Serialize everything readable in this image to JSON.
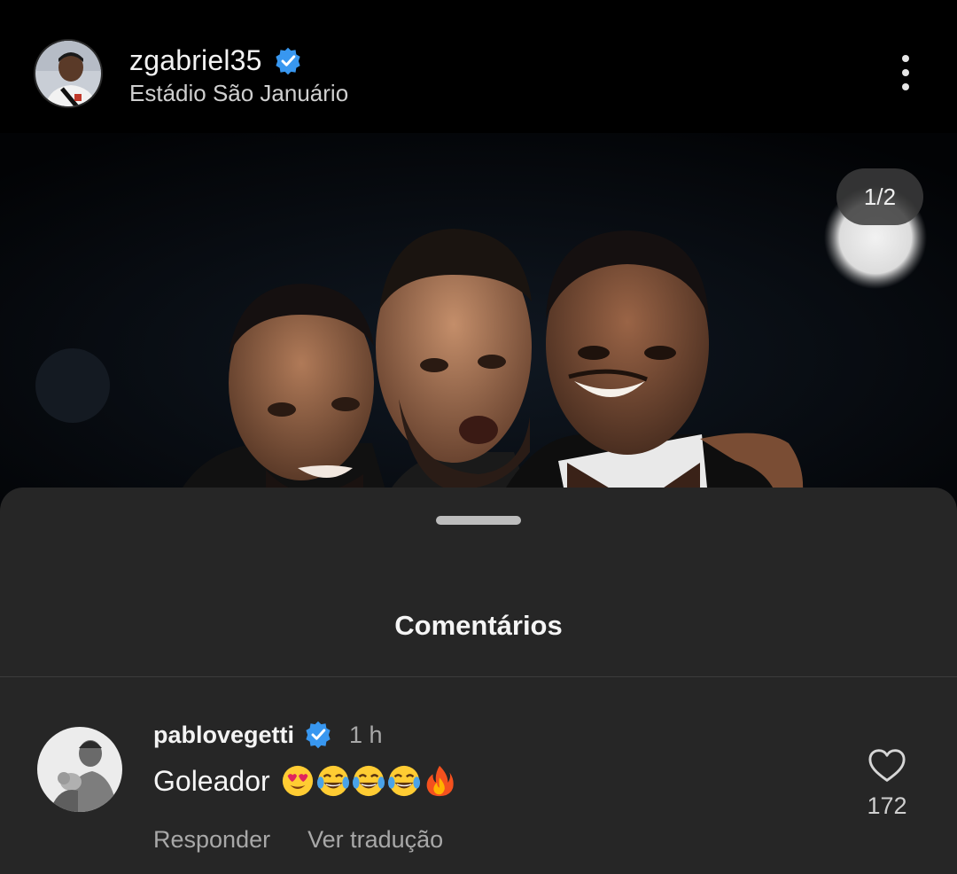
{
  "post": {
    "username": "zgabriel35",
    "location": "Estádio São Januário",
    "page_indicator": "1/2"
  },
  "comments_sheet": {
    "title": "Comentários",
    "comments": [
      {
        "username": "pablovegetti",
        "time": "1 h",
        "text": "Goleador",
        "emojis": [
          "heart-eyes-emoji",
          "tears-of-joy-emoji",
          "tears-of-joy-emoji",
          "tears-of-joy-emoji",
          "fire-emoji"
        ],
        "reply_label": "Responder",
        "translate_label": "Ver tradução",
        "like_count": "172"
      }
    ]
  },
  "colors": {
    "background": "#000000",
    "sheet": "#262626",
    "verified": "#3897f0",
    "secondary_text": "#a8a8a8"
  }
}
